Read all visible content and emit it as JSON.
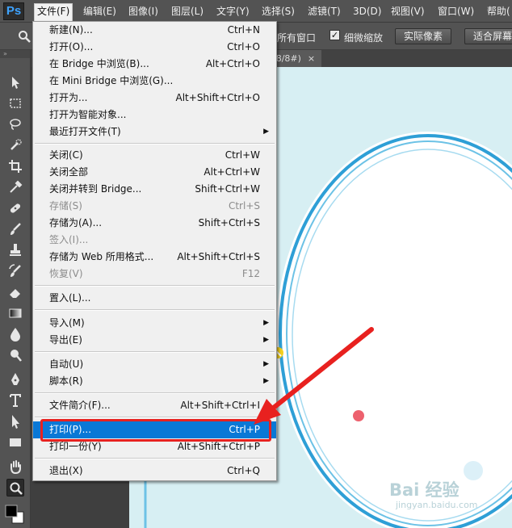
{
  "app": {
    "logo": "Ps"
  },
  "menubar": {
    "items": [
      "文件(F)",
      "编辑(E)",
      "图像(I)",
      "图层(L)",
      "文字(Y)",
      "选择(S)",
      "滤镜(T)",
      "3D(D)",
      "视图(V)",
      "窗口(W)",
      "帮助("
    ]
  },
  "options": {
    "all_windows_label": "所有窗口",
    "scrubby_zoom_label": "细微缩放",
    "actual_pixels_label": "实际像素",
    "fit_screen_label": "适合屏幕"
  },
  "document": {
    "tab_label": "/8/8#)",
    "close_glyph": "×"
  },
  "file_menu": {
    "items": [
      {
        "label": "新建(N)...",
        "shortcut": "Ctrl+N"
      },
      {
        "label": "打开(O)...",
        "shortcut": "Ctrl+O"
      },
      {
        "label": "在 Bridge 中浏览(B)...",
        "shortcut": "Alt+Ctrl+O"
      },
      {
        "label": "在 Mini Bridge 中浏览(G)...",
        "shortcut": ""
      },
      {
        "label": "打开为...",
        "shortcut": "Alt+Shift+Ctrl+O"
      },
      {
        "label": "打开为智能对象...",
        "shortcut": ""
      },
      {
        "label": "最近打开文件(T)",
        "shortcut": ""
      },
      {
        "label": "关闭(C)",
        "shortcut": "Ctrl+W"
      },
      {
        "label": "关闭全部",
        "shortcut": "Alt+Ctrl+W"
      },
      {
        "label": "关闭并转到 Bridge...",
        "shortcut": "Shift+Ctrl+W"
      },
      {
        "label": "存储(S)",
        "shortcut": "Ctrl+S"
      },
      {
        "label": "存储为(A)...",
        "shortcut": "Shift+Ctrl+S"
      },
      {
        "label": "签入(I)...",
        "shortcut": ""
      },
      {
        "label": "存储为 Web 所用格式...",
        "shortcut": "Alt+Shift+Ctrl+S"
      },
      {
        "label": "恢复(V)",
        "shortcut": "F12"
      },
      {
        "label": "置入(L)...",
        "shortcut": ""
      },
      {
        "label": "导入(M)",
        "shortcut": ""
      },
      {
        "label": "导出(E)",
        "shortcut": ""
      },
      {
        "label": "自动(U)",
        "shortcut": ""
      },
      {
        "label": "脚本(R)",
        "shortcut": ""
      },
      {
        "label": "文件简介(F)...",
        "shortcut": "Alt+Shift+Ctrl+I"
      },
      {
        "label": "打印(P)...",
        "shortcut": "Ctrl+P"
      },
      {
        "label": "打印一份(Y)",
        "shortcut": "Alt+Shift+Ctrl+P"
      },
      {
        "label": "退出(X)",
        "shortcut": "Ctrl+Q"
      }
    ],
    "submenu_glyph": "▶"
  },
  "watermark": {
    "text": "Bai 经验",
    "subtext": "jingyan.baidu.com"
  },
  "colors": {
    "highlight": "#0a78d6",
    "annotation_red": "#e8211f",
    "menu_bg": "#f0f0f0",
    "app_bg": "#535353"
  }
}
